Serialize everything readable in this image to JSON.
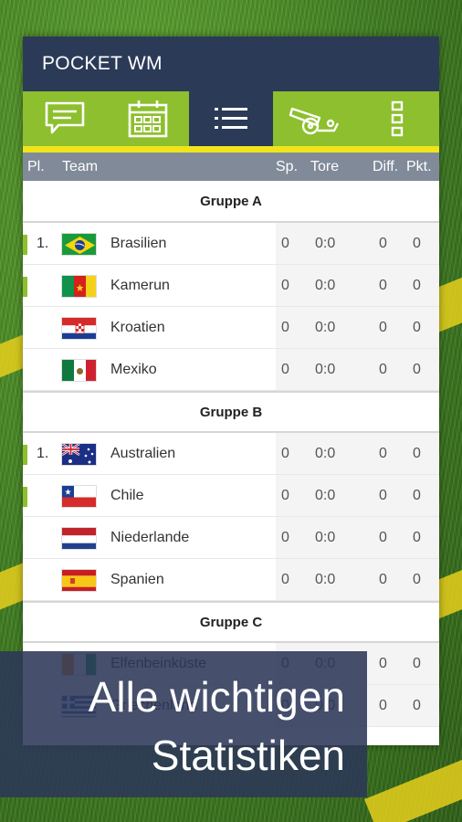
{
  "app": {
    "title": "POCKET WM"
  },
  "tabs": [
    {
      "icon": "chat-icon",
      "active": false
    },
    {
      "icon": "calendar-icon",
      "active": false
    },
    {
      "icon": "list-icon",
      "active": true
    },
    {
      "icon": "cannon-icon",
      "active": false
    },
    {
      "icon": "more-vertical-icon",
      "active": false
    }
  ],
  "colors": {
    "appbar": "#2b3a57",
    "tabbar": "#8dbf2e",
    "accent": "#f1e41c",
    "header": "#808a99"
  },
  "table": {
    "headers": {
      "place": "Pl.",
      "team": "Team",
      "played": "Sp.",
      "goals": "Tore",
      "diff": "Diff.",
      "points": "Pkt."
    },
    "groups": [
      {
        "name": "Gruppe A",
        "rows": [
          {
            "place": "1.",
            "team": "Brasilien",
            "flag": "brazil",
            "qualified": true,
            "played": "0",
            "goals": "0:0",
            "diff": "0",
            "points": "0"
          },
          {
            "place": "",
            "team": "Kamerun",
            "flag": "cameroon",
            "qualified": true,
            "played": "0",
            "goals": "0:0",
            "diff": "0",
            "points": "0"
          },
          {
            "place": "",
            "team": "Kroatien",
            "flag": "croatia",
            "qualified": false,
            "played": "0",
            "goals": "0:0",
            "diff": "0",
            "points": "0"
          },
          {
            "place": "",
            "team": "Mexiko",
            "flag": "mexico",
            "qualified": false,
            "played": "0",
            "goals": "0:0",
            "diff": "0",
            "points": "0"
          }
        ]
      },
      {
        "name": "Gruppe B",
        "rows": [
          {
            "place": "1.",
            "team": "Australien",
            "flag": "australia",
            "qualified": true,
            "played": "0",
            "goals": "0:0",
            "diff": "0",
            "points": "0"
          },
          {
            "place": "",
            "team": "Chile",
            "flag": "chile",
            "qualified": true,
            "played": "0",
            "goals": "0:0",
            "diff": "0",
            "points": "0"
          },
          {
            "place": "",
            "team": "Niederlande",
            "flag": "netherlands",
            "qualified": false,
            "played": "0",
            "goals": "0:0",
            "diff": "0",
            "points": "0"
          },
          {
            "place": "",
            "team": "Spanien",
            "flag": "spain",
            "qualified": false,
            "played": "0",
            "goals": "0:0",
            "diff": "0",
            "points": "0"
          }
        ]
      },
      {
        "name": "Gruppe C",
        "rows": [
          {
            "place": "",
            "team": "Elfenbeinküste",
            "flag": "ivory-coast",
            "qualified": false,
            "played": "0",
            "goals": "0:0",
            "diff": "0",
            "points": "0"
          },
          {
            "place": "",
            "team": "Griechenland",
            "flag": "greece",
            "qualified": false,
            "played": "0",
            "goals": "0:0",
            "diff": "0",
            "points": "0"
          }
        ]
      }
    ]
  },
  "caption": {
    "line1": "Alle wichtigen",
    "line2": "Statistiken"
  }
}
